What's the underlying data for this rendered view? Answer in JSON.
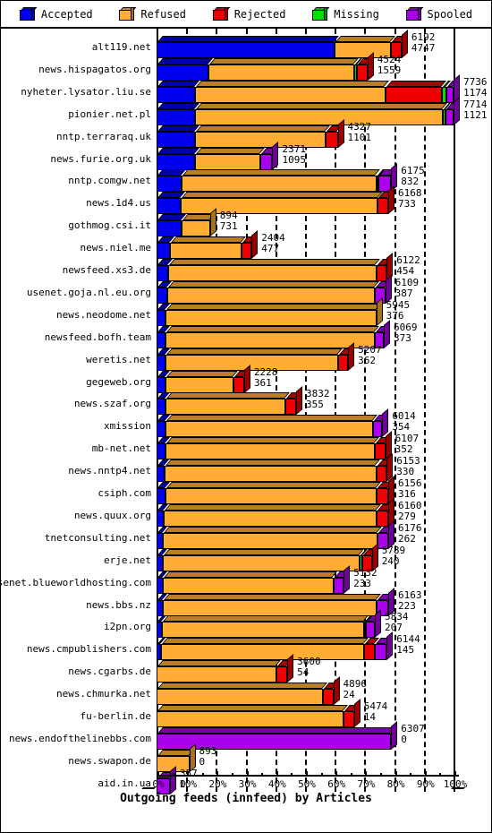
{
  "legend": {
    "items": [
      {
        "label": "Accepted",
        "color": "#0000ee",
        "icon": "cube-icon"
      },
      {
        "label": "Refused",
        "color": "#ffad33",
        "icon": "cube-icon"
      },
      {
        "label": "Rejected",
        "color": "#ee0000",
        "icon": "cube-icon"
      },
      {
        "label": "Missing",
        "color": "#00e000",
        "icon": "cube-icon"
      },
      {
        "label": "Spooled",
        "color": "#aa00ee",
        "icon": "cube-icon"
      }
    ]
  },
  "axis": {
    "title": "Outgoing feeds (innfeed) by Articles",
    "xticks": [
      "0%",
      "10%",
      "20%",
      "30%",
      "40%",
      "50%",
      "60%",
      "70%",
      "80%",
      "90%",
      "100%"
    ],
    "xmin": 0,
    "xmax": 100
  },
  "chart_data": {
    "type": "bar",
    "orientation": "horizontal-stacked",
    "title": "Outgoing feeds (innfeed) by Articles",
    "xlabel": "Outgoing feeds (innfeed) by Articles",
    "ylabel": "",
    "xlim": [
      0,
      100
    ],
    "xtick_labels": [
      "0%",
      "10%",
      "20%",
      "30%",
      "40%",
      "50%",
      "60%",
      "70%",
      "80%",
      "90%",
      "100%"
    ],
    "grid": true,
    "legend_position": "top",
    "series": [
      {
        "name": "Accepted",
        "color": "#0000ee"
      },
      {
        "name": "Refused",
        "color": "#ffad33"
      },
      {
        "name": "Rejected",
        "color": "#ee0000"
      },
      {
        "name": "Missing",
        "color": "#00e000"
      },
      {
        "name": "Spooled",
        "color": "#aa00ee"
      }
    ],
    "categories": [
      "alt119.net",
      "news.hispagatos.org",
      "nyheter.lysator.liu.se",
      "pionier.net.pl",
      "nntp.terraraq.uk",
      "news.furie.org.uk",
      "nntp.comgw.net",
      "news.1d4.us",
      "gothmog.csi.it",
      "news.niel.me",
      "newsfeed.xs3.de",
      "usenet.goja.nl.eu.org",
      "news.neodome.net",
      "newsfeed.bofh.team",
      "weretis.net",
      "gegeweb.org",
      "news.szaf.org",
      "xmission",
      "mb-net.net",
      "news.nntp4.net",
      "csiph.com",
      "news.quux.org",
      "tnetconsulting.net",
      "erje.net",
      "usenet.blueworldhosting.com",
      "news.bbs.nz",
      "i2pn.org",
      "news.cmpublishers.com",
      "news.cgarbs.de",
      "news.chmurka.net",
      "fu-berlin.de",
      "news.endofthelinebbs.com",
      "news.swapon.de",
      "aid.in.ua"
    ],
    "rows": [
      {
        "label": "alt119.net",
        "labels": [
          "6192",
          "4747"
        ],
        "total_pct": 82.5,
        "segments": [
          {
            "s": "Accepted",
            "pct": 60.0
          },
          {
            "s": "Refused",
            "pct": 19.0
          },
          {
            "s": "Rejected",
            "pct": 3.5
          }
        ]
      },
      {
        "label": "news.hispagatos.org",
        "labels": [
          "4524",
          "1559"
        ],
        "total_pct": 71.0,
        "segments": [
          {
            "s": "Accepted",
            "pct": 17.5
          },
          {
            "s": "Refused",
            "pct": 49.0
          },
          {
            "s": "Missing",
            "pct": 1.0
          },
          {
            "s": "Rejected",
            "pct": 3.5
          }
        ]
      },
      {
        "label": "nyheter.lysator.liu.se",
        "labels": [
          "7736",
          "1174"
        ],
        "total_pct": 100.0,
        "segments": [
          {
            "s": "Accepted",
            "pct": 13.0
          },
          {
            "s": "Refused",
            "pct": 64.0
          },
          {
            "s": "Rejected",
            "pct": 19.0
          },
          {
            "s": "Missing",
            "pct": 1.5
          },
          {
            "s": "Spooled",
            "pct": 2.5
          }
        ]
      },
      {
        "label": "pionier.net.pl",
        "labels": [
          "7714",
          "1121"
        ],
        "total_pct": 100.0,
        "segments": [
          {
            "s": "Accepted",
            "pct": 13.0
          },
          {
            "s": "Refused",
            "pct": 83.5
          },
          {
            "s": "Missing",
            "pct": 0.7
          },
          {
            "s": "Spooled",
            "pct": 2.8
          }
        ]
      },
      {
        "label": "nntp.terraraq.uk",
        "labels": [
          "4327",
          "1101"
        ],
        "total_pct": 61.0,
        "segments": [
          {
            "s": "Accepted",
            "pct": 13.0
          },
          {
            "s": "Refused",
            "pct": 44.0
          },
          {
            "s": "Rejected",
            "pct": 4.0
          }
        ]
      },
      {
        "label": "news.furie.org.uk",
        "labels": [
          "2371",
          "1095"
        ],
        "total_pct": 39.0,
        "segments": [
          {
            "s": "Accepted",
            "pct": 13.0
          },
          {
            "s": "Refused",
            "pct": 22.0
          },
          {
            "s": "Spooled",
            "pct": 4.0
          }
        ]
      },
      {
        "label": "nntp.comgw.net",
        "labels": [
          "6175",
          "832"
        ],
        "total_pct": 79.0,
        "segments": [
          {
            "s": "Accepted",
            "pct": 8.5
          },
          {
            "s": "Refused",
            "pct": 65.5
          },
          {
            "s": "Rejected",
            "pct": 0.6
          },
          {
            "s": "Spooled",
            "pct": 4.4
          }
        ]
      },
      {
        "label": "news.1d4.us",
        "labels": [
          "6168",
          "733"
        ],
        "total_pct": 78.0,
        "segments": [
          {
            "s": "Accepted",
            "pct": 8.0
          },
          {
            "s": "Refused",
            "pct": 66.5
          },
          {
            "s": "Rejected",
            "pct": 3.5
          }
        ]
      },
      {
        "label": "gothmog.csi.it",
        "labels": [
          "894",
          "731"
        ],
        "total_pct": 18.0,
        "segments": [
          {
            "s": "Accepted",
            "pct": 8.5
          },
          {
            "s": "Refused",
            "pct": 9.5
          }
        ]
      },
      {
        "label": "news.niel.me",
        "labels": [
          "2404",
          "477"
        ],
        "total_pct": 32.0,
        "segments": [
          {
            "s": "Accepted",
            "pct": 4.5
          },
          {
            "s": "Refused",
            "pct": 24.0
          },
          {
            "s": "Rejected",
            "pct": 3.5
          }
        ]
      },
      {
        "label": "newsfeed.xs3.de",
        "labels": [
          "6122",
          "454"
        ],
        "total_pct": 77.5,
        "segments": [
          {
            "s": "Accepted",
            "pct": 4.0
          },
          {
            "s": "Refused",
            "pct": 70.0
          },
          {
            "s": "Rejected",
            "pct": 3.5
          }
        ]
      },
      {
        "label": "usenet.goja.nl.eu.org",
        "labels": [
          "6109",
          "387"
        ],
        "total_pct": 77.0,
        "segments": [
          {
            "s": "Accepted",
            "pct": 3.5
          },
          {
            "s": "Refused",
            "pct": 70.0
          },
          {
            "s": "Spooled",
            "pct": 3.5
          }
        ]
      },
      {
        "label": "news.neodome.net",
        "labels": [
          "5945",
          "376"
        ],
        "total_pct": 74.0,
        "segments": [
          {
            "s": "Accepted",
            "pct": 3.0
          },
          {
            "s": "Refused",
            "pct": 71.0
          }
        ]
      },
      {
        "label": "newsfeed.bofh.team",
        "labels": [
          "6069",
          "373"
        ],
        "total_pct": 76.5,
        "segments": [
          {
            "s": "Accepted",
            "pct": 3.0
          },
          {
            "s": "Refused",
            "pct": 70.5
          },
          {
            "s": "Spooled",
            "pct": 3.0
          }
        ]
      },
      {
        "label": "weretis.net",
        "labels": [
          "5207",
          "362"
        ],
        "total_pct": 64.5,
        "segments": [
          {
            "s": "Accepted",
            "pct": 3.0
          },
          {
            "s": "Refused",
            "pct": 58.0
          },
          {
            "s": "Rejected",
            "pct": 3.5
          }
        ]
      },
      {
        "label": "gegeweb.org",
        "labels": [
          "2228",
          "361"
        ],
        "total_pct": 29.5,
        "segments": [
          {
            "s": "Accepted",
            "pct": 3.0
          },
          {
            "s": "Refused",
            "pct": 23.0
          },
          {
            "s": "Rejected",
            "pct": 3.5
          }
        ]
      },
      {
        "label": "news.szaf.org",
        "labels": [
          "3832",
          "355"
        ],
        "total_pct": 47.0,
        "segments": [
          {
            "s": "Accepted",
            "pct": 3.0
          },
          {
            "s": "Refused",
            "pct": 40.5
          },
          {
            "s": "Rejected",
            "pct": 3.5
          }
        ]
      },
      {
        "label": "xmission",
        "labels": [
          "6014",
          "354"
        ],
        "total_pct": 76.0,
        "segments": [
          {
            "s": "Accepted",
            "pct": 3.0
          },
          {
            "s": "Refused",
            "pct": 70.0
          },
          {
            "s": "Spooled",
            "pct": 3.0
          }
        ]
      },
      {
        "label": "mb-net.net",
        "labels": [
          "6107",
          "352"
        ],
        "total_pct": 77.0,
        "segments": [
          {
            "s": "Accepted",
            "pct": 3.0
          },
          {
            "s": "Refused",
            "pct": 70.5
          },
          {
            "s": "Rejected",
            "pct": 3.5
          }
        ]
      },
      {
        "label": "news.nntp4.net",
        "labels": [
          "6153",
          "330"
        ],
        "total_pct": 77.5,
        "segments": [
          {
            "s": "Accepted",
            "pct": 2.8
          },
          {
            "s": "Refused",
            "pct": 71.2
          },
          {
            "s": "Rejected",
            "pct": 3.5
          }
        ]
      },
      {
        "label": "csiph.com",
        "labels": [
          "6156",
          "316"
        ],
        "total_pct": 78.0,
        "segments": [
          {
            "s": "Accepted",
            "pct": 3.0
          },
          {
            "s": "Refused",
            "pct": 71.0
          },
          {
            "s": "Rejected",
            "pct": 4.0
          }
        ]
      },
      {
        "label": "news.quux.org",
        "labels": [
          "6160",
          "279"
        ],
        "total_pct": 78.0,
        "segments": [
          {
            "s": "Accepted",
            "pct": 2.3
          },
          {
            "s": "Refused",
            "pct": 71.7
          },
          {
            "s": "Rejected",
            "pct": 4.0
          }
        ]
      },
      {
        "label": "tnetconsulting.net",
        "labels": [
          "6176",
          "262"
        ],
        "total_pct": 78.0,
        "segments": [
          {
            "s": "Accepted",
            "pct": 2.2
          },
          {
            "s": "Refused",
            "pct": 72.3
          },
          {
            "s": "Spooled",
            "pct": 3.5
          }
        ]
      },
      {
        "label": "erje.net",
        "labels": [
          "5789",
          "240"
        ],
        "total_pct": 72.5,
        "segments": [
          {
            "s": "Accepted",
            "pct": 2.2
          },
          {
            "s": "Refused",
            "pct": 66.3
          },
          {
            "s": "Missing",
            "pct": 0.8
          },
          {
            "s": "Rejected",
            "pct": 3.2
          }
        ]
      },
      {
        "label": "usenet.blueworldhosting.com",
        "labels": [
          "5132",
          "233"
        ],
        "total_pct": 63.0,
        "segments": [
          {
            "s": "Accepted",
            "pct": 2.2
          },
          {
            "s": "Refused",
            "pct": 57.3
          },
          {
            "s": "Spooled",
            "pct": 3.5
          }
        ]
      },
      {
        "label": "news.bbs.nz",
        "labels": [
          "6163",
          "223"
        ],
        "total_pct": 78.0,
        "segments": [
          {
            "s": "Accepted",
            "pct": 2.0
          },
          {
            "s": "Refused",
            "pct": 72.0
          },
          {
            "s": "Spooled",
            "pct": 4.0
          }
        ]
      },
      {
        "label": "i2pn.org",
        "labels": [
          "5834",
          "207"
        ],
        "total_pct": 73.5,
        "segments": [
          {
            "s": "Accepted",
            "pct": 1.8
          },
          {
            "s": "Refused",
            "pct": 68.2
          },
          {
            "s": "Missing",
            "pct": 0.5
          },
          {
            "s": "Spooled",
            "pct": 3.0
          }
        ]
      },
      {
        "label": "news.cmpublishers.com",
        "labels": [
          "6144",
          "145"
        ],
        "total_pct": 77.5,
        "segments": [
          {
            "s": "Accepted",
            "pct": 1.5
          },
          {
            "s": "Refused",
            "pct": 68.5
          },
          {
            "s": "Rejected",
            "pct": 3.5
          },
          {
            "s": "Spooled",
            "pct": 4.0
          }
        ]
      },
      {
        "label": "news.cgarbs.de",
        "labels": [
          "3600",
          "54"
        ],
        "total_pct": 44.0,
        "segments": [
          {
            "s": "Refused",
            "pct": 40.5
          },
          {
            "s": "Rejected",
            "pct": 3.5
          }
        ]
      },
      {
        "label": "news.chmurka.net",
        "labels": [
          "4896",
          "24"
        ],
        "total_pct": 59.5,
        "segments": [
          {
            "s": "Refused",
            "pct": 56.0
          },
          {
            "s": "Rejected",
            "pct": 3.5
          }
        ]
      },
      {
        "label": "fu-berlin.de",
        "labels": [
          "5474",
          "14"
        ],
        "total_pct": 66.5,
        "segments": [
          {
            "s": "Refused",
            "pct": 63.0
          },
          {
            "s": "Rejected",
            "pct": 3.5
          }
        ]
      },
      {
        "label": "news.endofthelinebbs.com",
        "labels": [
          "6307",
          "0"
        ],
        "total_pct": 79.0,
        "segments": [
          {
            "s": "Spooled",
            "pct": 79.0
          }
        ]
      },
      {
        "label": "news.swapon.de",
        "labels": [
          "893",
          "0"
        ],
        "total_pct": 11.0,
        "segments": [
          {
            "s": "Refused",
            "pct": 11.0
          }
        ]
      },
      {
        "label": "aid.in.ua",
        "labels": [
          "357",
          "0"
        ],
        "total_pct": 4.5,
        "segments": [
          {
            "s": "Spooled",
            "pct": 4.5
          }
        ]
      }
    ]
  }
}
